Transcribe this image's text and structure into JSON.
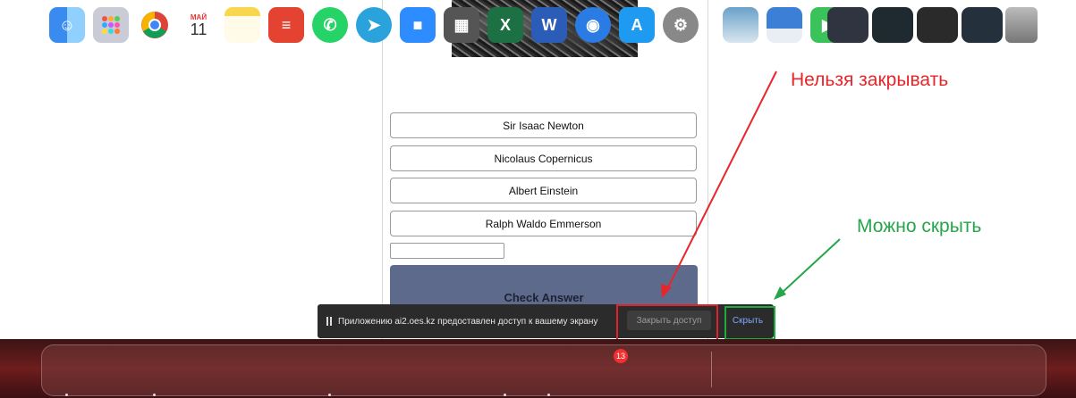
{
  "answers": [
    "Sir Isaac Newton",
    "Nicolaus Copernicus",
    "Albert Einstein",
    "Ralph Waldo Emmerson"
  ],
  "check_label": "Check Answer",
  "annotations": {
    "cannot_close": "Нельзя закрывать",
    "can_hide": "Можно скрыть"
  },
  "share_bar": {
    "message": "Приложению ai2.oes.kz предоставлен доступ к вашему экрану",
    "close_label": "Закрыть доступ",
    "hide_label": "Скрыть"
  },
  "dock": {
    "calendar_month": "МАЙ",
    "calendar_day": "11",
    "appstore_badge": "13",
    "excel_letter": "X",
    "word_letter": "W",
    "icons": [
      "finder-icon",
      "launchpad-icon",
      "chrome-icon",
      "calendar-icon",
      "notes-icon",
      "todoist-icon",
      "whatsapp-icon",
      "telegram-icon",
      "zoom-icon",
      "calculator-icon",
      "excel-icon",
      "word-icon",
      "podcasts-icon",
      "appstore-icon",
      "settings-icon",
      "preview-icon",
      "finder2-icon",
      "facetime-icon",
      "window-thumb-1-icon",
      "window-thumb-2-icon",
      "window-thumb-3-icon",
      "window-thumb-4-icon",
      "trash-icon"
    ]
  },
  "colors": {
    "red": "#e8262a",
    "green": "#27a54a",
    "check_button": "#5d6a8c"
  }
}
